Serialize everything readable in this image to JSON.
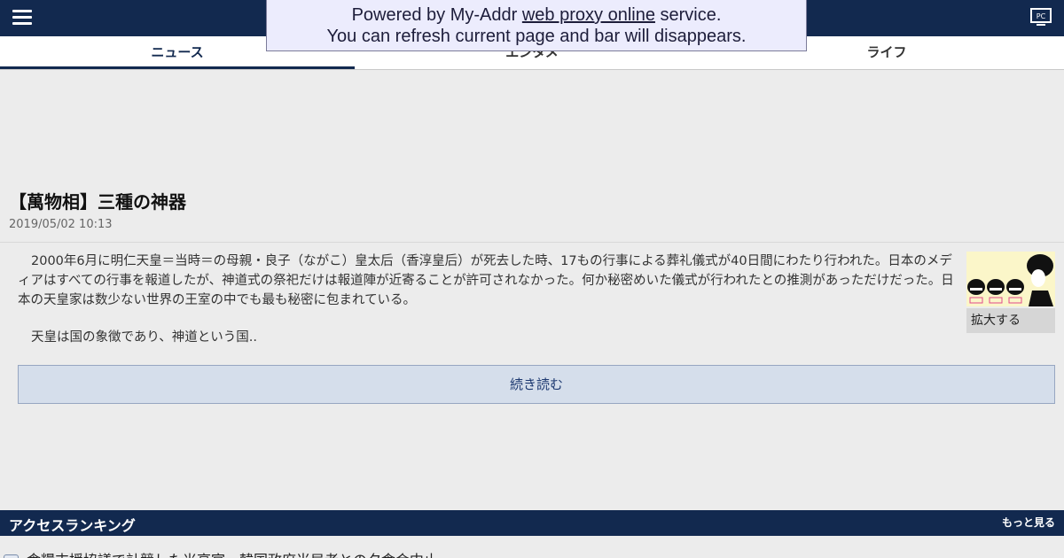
{
  "proxy_bar": {
    "prefix": "Powered by My-Addr ",
    "link": "web proxy online",
    "suffix": " service.",
    "line2": "You can refresh current page and bar will disappears."
  },
  "header": {
    "menu_icon": "hamburger-menu-icon",
    "pc_icon": "pc-monitor-icon",
    "pc_label": "PC"
  },
  "tabs": [
    {
      "label": "ニュース",
      "active": true
    },
    {
      "label": "エンタメ",
      "active": false
    },
    {
      "label": "ライフ",
      "active": false
    }
  ],
  "article": {
    "title": "【萬物相】三種の神器",
    "date": "2019/05/02 10:13",
    "paragraphs": [
      "2000年6月に明仁天皇＝当時＝の母親・良子（ながこ）皇太后（香淳皇后）が死去した時、17もの行事による葬礼儀式が40日間にわたり行われた。日本のメディアはすべての行事を報道したが、神道式の祭祀だけは報道陣が近寄ることが許可されなかった。何か秘密めいた儀式が行われたとの推測があっただけだった。日本の天皇家は数少ない世界の王室の中でも最も秘密に包まれている。",
      "天皇は国の象徴であり、神道という国.."
    ],
    "thumb_button": "拡大する",
    "read_more": "続き読む"
  },
  "ranking": {
    "title": "アクセスランキング",
    "more": "もっと見る",
    "items": [
      {
        "text": "食糧支援協議で計競した米高官、韓国政府当局者との夕食会中止"
      }
    ]
  },
  "colors": {
    "header_bg": "#12294f",
    "page_bg": "#ececec",
    "readmore_bg": "#d5deeb",
    "proxy_bg": "#ececfd"
  }
}
